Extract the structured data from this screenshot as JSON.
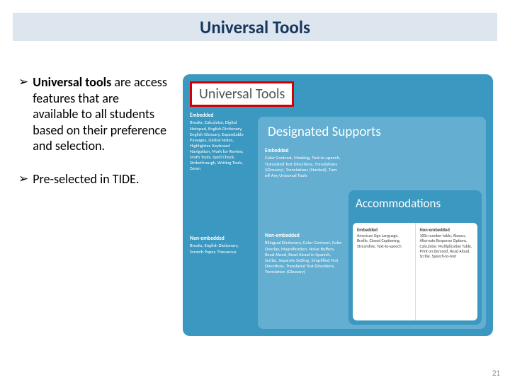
{
  "title": "Universal Tools",
  "bullets": [
    {
      "bold": "Universal tools",
      "rest": " are access features that are available to all students based on their preference and selection."
    },
    {
      "bold": "",
      "rest": "Pre-selected in TIDE."
    }
  ],
  "diagram": {
    "universal": {
      "label": "Universal Tools",
      "embedded": {
        "header": "Embedded",
        "items": "Breaks, Calculator, Digital Notepad, English Dictionary, English Glossary, Expandable Passages, Global Notes, Highlighter, Keyboard Navigation, Mark for Review, Math Tools, Spell Check, Strikethrough, Writing Tools, Zoom"
      },
      "nonembedded": {
        "header": "Non-embedded",
        "items": "Breaks, English Dictionary, Scratch Paper, Thesaurus"
      }
    },
    "designated": {
      "label": "Designated Supports",
      "embedded": {
        "header": "Embedded",
        "items": "Color Contrast, Masking, Text-to-speech, Translated Test Directions, Translations (Glossary), Translations (Stacked), Turn off Any Universal Tools"
      },
      "nonembedded": {
        "header": "Non-embedded",
        "items": "Bilingual Dictionary, Color Contrast, Color Overlay, Magnification, Noise Buffers, Read Aloud, Read Aloud in Spanish, Scribe, Separate Setting, Simplified Test Directions, Translated Test Directions, Translation (Glossary)"
      }
    },
    "accommodations": {
      "label": "Accommodations",
      "embedded": {
        "header": "Embedded",
        "items": "American Sign Language, Braille, Closed Captioning, Streamline, Text-to-speech"
      },
      "nonembedded": {
        "header": "Non-embedded",
        "items": "100s number table, Abacus, Alternate Response Options, Calculator, Multiplication Table, Print on Demand, Read Aloud, Scribe, Speech-to-text"
      }
    }
  },
  "page": "21"
}
